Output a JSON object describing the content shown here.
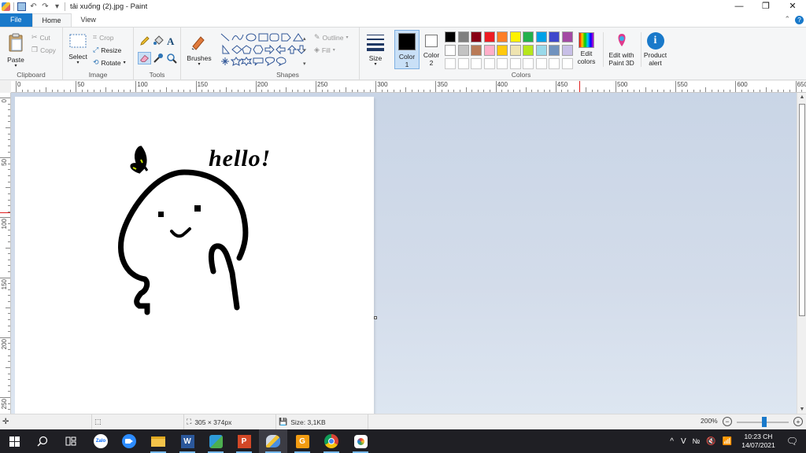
{
  "window": {
    "title": "tải xuống (2).jpg - Paint",
    "minimize_icon": "minimize-icon",
    "maximize_icon": "restore-icon",
    "close_icon": "close-icon"
  },
  "tabs": [
    {
      "label": "File"
    },
    {
      "label": "Home"
    },
    {
      "label": "View"
    }
  ],
  "ribbon": {
    "clipboard": {
      "label": "Clipboard",
      "paste": "Paste",
      "cut": "Cut",
      "copy": "Copy"
    },
    "image": {
      "label": "Image",
      "select": "Select",
      "crop": "Crop",
      "resize": "Resize",
      "rotate": "Rotate"
    },
    "tools": {
      "label": "Tools"
    },
    "brushes": {
      "label": "Brushes"
    },
    "shapes": {
      "label": "Shapes",
      "outline": "Outline",
      "fill": "Fill"
    },
    "size": {
      "label": "Size"
    },
    "color1": {
      "label": "Color",
      "sub": "1",
      "value": "#000000"
    },
    "color2": {
      "label": "Color",
      "sub": "2",
      "value": "#ffffff"
    },
    "colors": {
      "label": "Colors",
      "row1": [
        "#000000",
        "#7f7f7f",
        "#880015",
        "#ed1c24",
        "#ff7f27",
        "#fff200",
        "#22b14c",
        "#00a2e8",
        "#3f48cc",
        "#a349a4"
      ],
      "row2": [
        "#ffffff",
        "#c3c3c3",
        "#b97a57",
        "#ffaec9",
        "#ffc90e",
        "#efe4b0",
        "#b5e61d",
        "#99d9ea",
        "#7092be",
        "#c8bfe7"
      ]
    },
    "edit_colors": {
      "line1": "Edit",
      "line2": "colors"
    },
    "paint3d": {
      "line1": "Edit with",
      "line2": "Paint 3D"
    },
    "product_alert": {
      "line1": "Product",
      "line2": "alert"
    }
  },
  "ruler": {
    "h_labels": [
      "0",
      "50",
      "100",
      "150",
      "200",
      "250",
      "300",
      "350",
      "400",
      "450",
      "500",
      "550",
      "600",
      "650"
    ],
    "v_labels": [
      "0",
      "50",
      "100",
      "150",
      "200",
      "250"
    ]
  },
  "canvas": {
    "text": "hello!"
  },
  "status": {
    "dimensions": "305 × 374px",
    "size": "Size: 3,1KB",
    "zoom": "200%"
  },
  "taskbar": {
    "time": "10:23 CH",
    "date": "14/07/2021"
  }
}
